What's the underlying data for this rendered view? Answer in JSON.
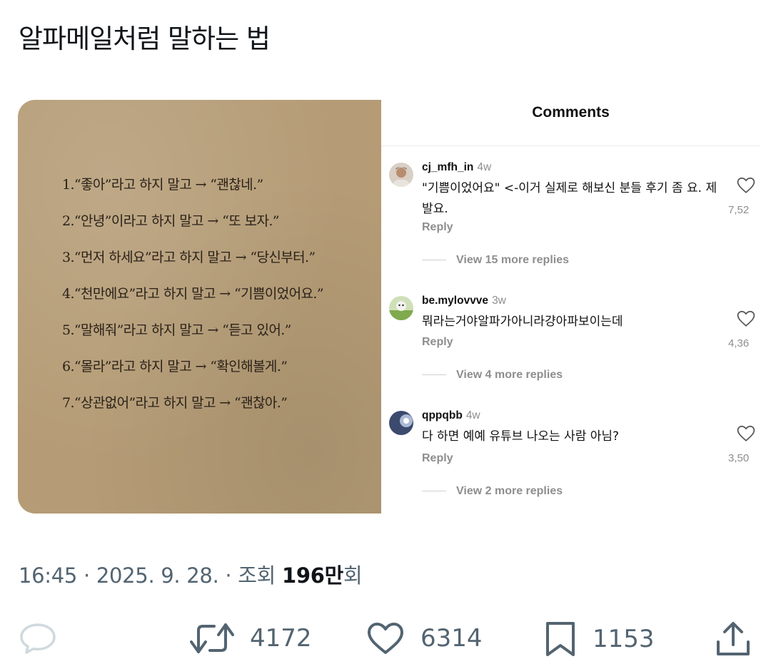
{
  "post": {
    "title": "알파메일처럼 말하는 법"
  },
  "image": {
    "book_lines": [
      "1.“좋아”라고 하지 말고 → “괜찮네.”",
      "2.“안녕”이라고 하지 말고 → “또 보자.”",
      "3.“먼저 하세요”라고 하지 말고 → “당신부터.”",
      "4.“천만에요”라고 하지 말고 → “기쁨이었어요.”",
      "5.“말해줘”라고 하지 말고 → “듣고 있어.”",
      "6.“몰라”라고 하지 말고 → “확인해볼게.”",
      "7.“상관없어”라고 하지 말고 → “괜찮아.”"
    ],
    "comments_header": "Comments",
    "comments": [
      {
        "user": "cj_mfh_in",
        "time": "4w",
        "text": "\"기쁨이었어요\" <-이거 실제로 해보신 분들 후기 좀 요. 제발요.",
        "reply": "Reply",
        "more": "View 15 more replies",
        "likes": "7,52"
      },
      {
        "user": "be.mylovvve",
        "time": "3w",
        "text": "뭐라는거야알파가아니라걍아파보이는데",
        "reply": "Reply",
        "more": "View 4 more replies",
        "likes": "4,36"
      },
      {
        "user": "qppqbb",
        "time": "4w",
        "text": "다 하면 예예 유튜브 나오는 사람 아님?",
        "reply": "Reply",
        "more": "View 2 more replies",
        "likes": "3,50"
      }
    ]
  },
  "meta": {
    "time": "16:45",
    "sep1": " · ",
    "date": "2025. 9. 28.",
    "sep2": " · ",
    "views_label": "조회 ",
    "views_number": "196만",
    "views_suffix": "회"
  },
  "actions": {
    "reply_icon": "comment-bubble-icon",
    "retweet_count": "4172",
    "like_count": "6314",
    "bookmark_count": "1153",
    "share_icon": "share-upload-icon"
  },
  "colors": {
    "text_primary": "#0f1419",
    "text_secondary": "#536471",
    "paper": "#b59c76",
    "comment_meta": "#8e8e8e"
  }
}
